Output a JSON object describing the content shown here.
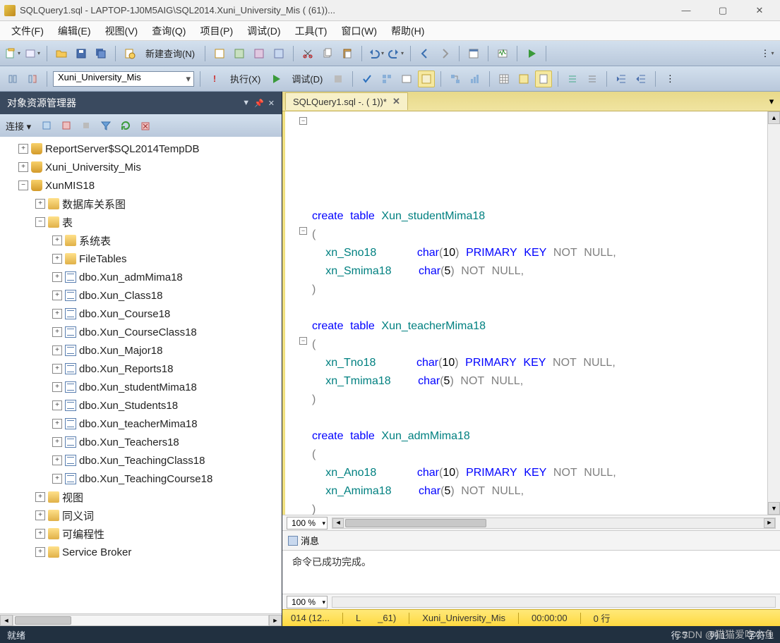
{
  "window": {
    "title": "SQLQuery1.sql - LAPTOP-1J0M5AIG\\SQL2014.Xuni_University_Mis (                          (61))..."
  },
  "menu": {
    "file": "文件(F)",
    "edit": "编辑(E)",
    "view": "视图(V)",
    "query": "查询(Q)",
    "project": "项目(P)",
    "debug": "调试(D)",
    "tools": "工具(T)",
    "window": "窗口(W)",
    "help": "帮助(H)"
  },
  "toolbar1": {
    "new_query": "新建查询(N)"
  },
  "toolbar2": {
    "database": "Xuni_University_Mis",
    "execute": "执行(X)",
    "debug": "调试(D)"
  },
  "sidebar": {
    "title": "对象资源管理器",
    "connect": "连接",
    "nodes": {
      "reportserver": "ReportServer$SQL2014TempDB",
      "xuni": "Xuni_University_Mis",
      "xunmis": "XunMIS18",
      "diagrams": "数据库关系图",
      "tables": "表",
      "systables": "系统表",
      "filetables": "FileTables",
      "t1": "dbo.Xun_admMima18",
      "t2": "dbo.Xun_Class18",
      "t3": "dbo.Xun_Course18",
      "t4": "dbo.Xun_CourseClass18",
      "t5": "dbo.Xun_Major18",
      "t6": "dbo.Xun_Reports18",
      "t7": "dbo.Xun_studentMima18",
      "t8": "dbo.Xun_Students18",
      "t9": "dbo.Xun_teacherMima18",
      "t10": "dbo.Xun_Teachers18",
      "t11": "dbo.Xun_TeachingClass18",
      "t12": "dbo.Xun_TeachingCourse18",
      "views": "视图",
      "synonyms": "同义词",
      "programmability": "可编程性",
      "servicebroker": "Service Broker"
    }
  },
  "tab": {
    "label": "SQLQuery1.sql -. (                    1))*"
  },
  "sql": {
    "create": "create",
    "table": "table",
    "char": "char",
    "pk": "PRIMARY",
    "key": "KEY",
    "not": "NOT",
    "null": "NULL",
    "t1": "Xun_studentMima18",
    "c1a": "xn_Sno18",
    "c1b": "xn_Smima18",
    "t2": "Xun_teacherMima18",
    "c2a": "xn_Tno18",
    "c2b": "xn_Tmima18",
    "t3": "Xun_admMima18",
    "c3a": "xn_Ano18",
    "c3b": "xn_Amima18",
    "n10": "10",
    "n5": "5",
    "comma": ",",
    "lp": "(",
    "rp": ")"
  },
  "zoom": {
    "val": "100 %"
  },
  "messages": {
    "tab": "消息",
    "text": "命令已成功完成。"
  },
  "status_y": {
    "s1": "014 (12...",
    "s2": "L",
    "s3": "_61)",
    "db": "Xuni_University_Mis",
    "time": "00:00:00",
    "rows": "0 行"
  },
  "statusbar": {
    "ready": "就绪",
    "row": "行 7",
    "col": "列 1",
    "char": "字符 1"
  },
  "watermark": "CSDN @猫猫爱吃小鱼"
}
